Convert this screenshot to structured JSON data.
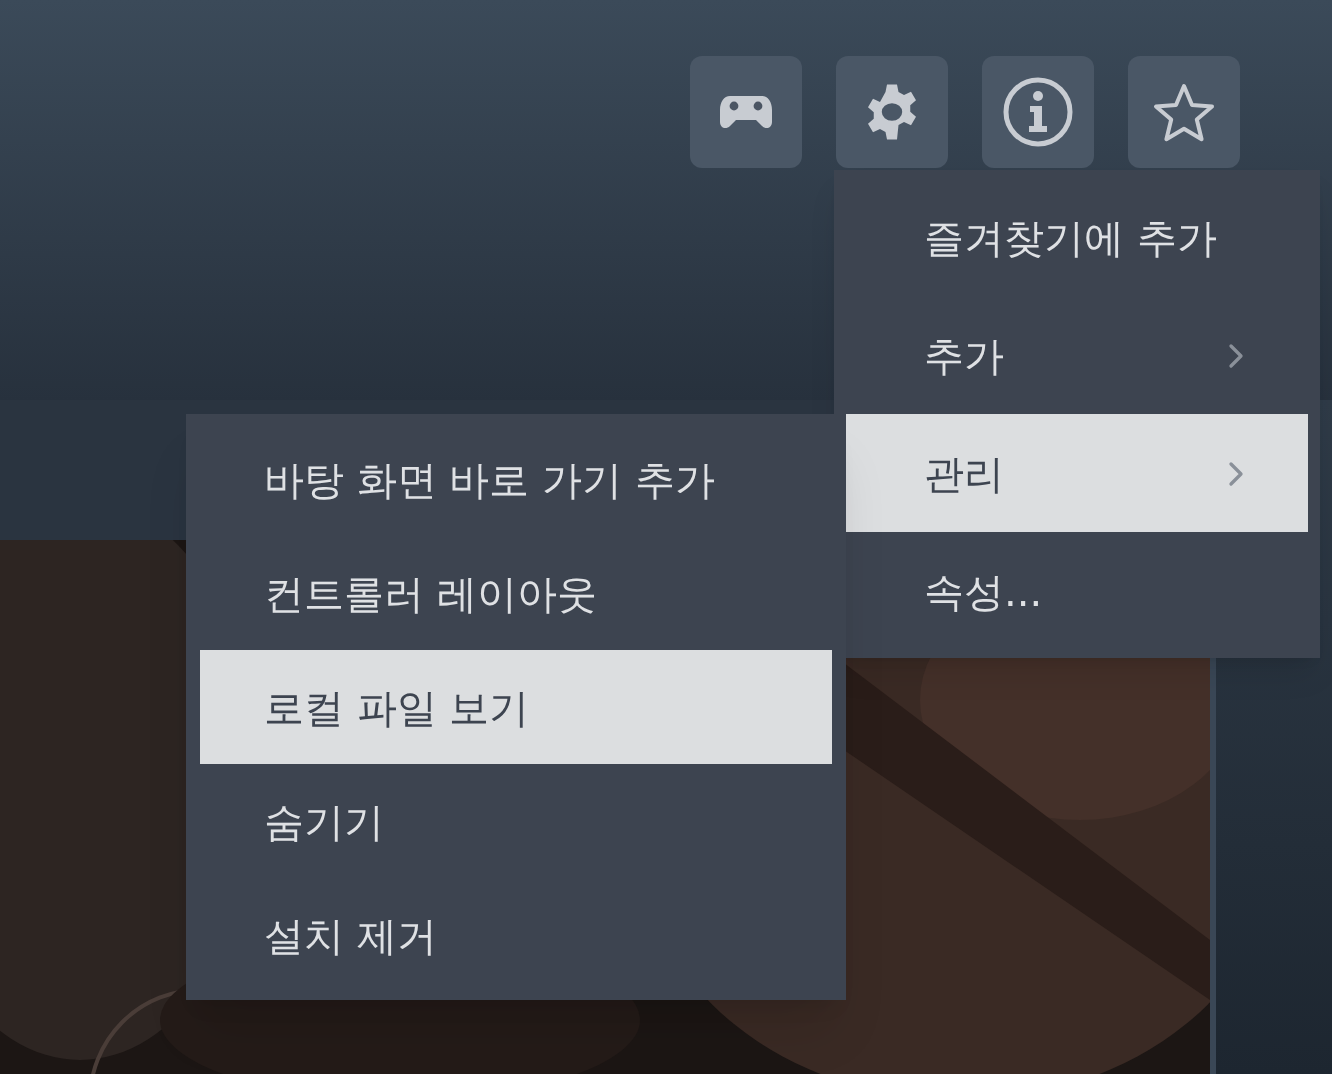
{
  "toolbar": [
    {
      "kind": "controller"
    },
    {
      "kind": "gear"
    },
    {
      "kind": "info"
    },
    {
      "kind": "star"
    }
  ],
  "context_menu": {
    "items": [
      {
        "label": "즐겨찾기에 추가",
        "submenu": false,
        "selected": false
      },
      {
        "label": "추가",
        "submenu": true,
        "selected": false
      },
      {
        "label": "관리",
        "submenu": true,
        "selected": true
      },
      {
        "label": "속성...",
        "submenu": false,
        "selected": false
      }
    ]
  },
  "submenu": {
    "items": [
      {
        "label": "바탕 화면 바로 가기 추가",
        "selected": false
      },
      {
        "label": "컨트롤러 레이아웃",
        "selected": false
      },
      {
        "label": "로컬 파일 보기",
        "selected": true
      },
      {
        "label": "숨기기",
        "selected": false
      },
      {
        "label": "설치 제거",
        "selected": false
      }
    ]
  }
}
